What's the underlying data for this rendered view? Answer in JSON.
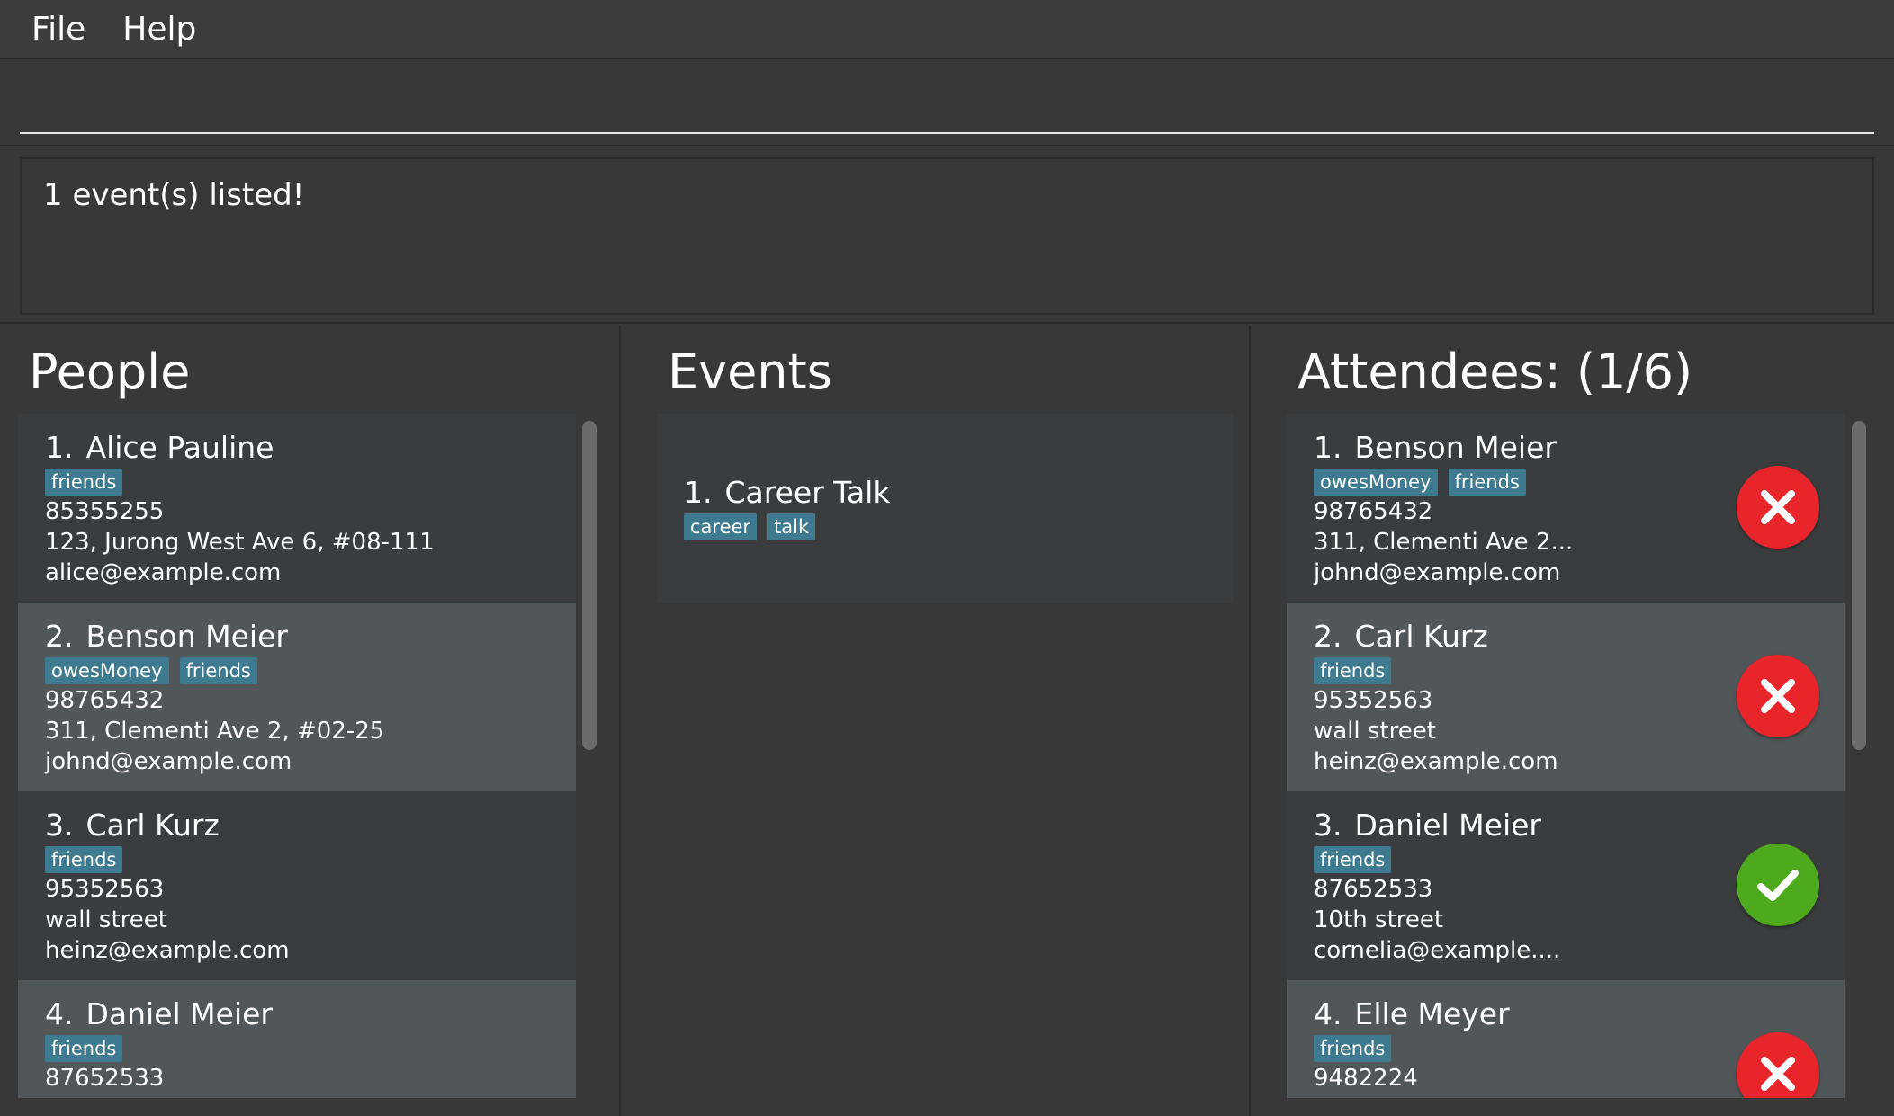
{
  "menu": {
    "items": [
      {
        "label": "File"
      },
      {
        "label": "Help"
      }
    ]
  },
  "command": {
    "value": "",
    "placeholder": ""
  },
  "result": {
    "text": "1 event(s) listed!"
  },
  "people": {
    "title": "People",
    "items": [
      {
        "index": "1.",
        "name": "Alice Pauline",
        "tags": [
          "friends"
        ],
        "phone": "85355255",
        "address": "123, Jurong West Ave 6, #08-111",
        "email": "alice@example.com"
      },
      {
        "index": "2.",
        "name": "Benson Meier",
        "tags": [
          "owesMoney",
          "friends"
        ],
        "phone": "98765432",
        "address": "311, Clementi Ave 2, #02-25",
        "email": "johnd@example.com"
      },
      {
        "index": "3.",
        "name": "Carl Kurz",
        "tags": [
          "friends"
        ],
        "phone": "95352563",
        "address": "wall street",
        "email": "heinz@example.com"
      },
      {
        "index": "4.",
        "name": "Daniel Meier",
        "tags": [
          "friends"
        ],
        "phone": "87652533",
        "address": "",
        "email": ""
      }
    ]
  },
  "events": {
    "title": "Events",
    "items": [
      {
        "index": "1.",
        "name": "Career Talk",
        "tags": [
          "career",
          "talk"
        ]
      }
    ]
  },
  "attendees": {
    "title": "Attendees: (1/6)",
    "items": [
      {
        "index": "1.",
        "name": "Benson Meier",
        "tags": [
          "owesMoney",
          "friends"
        ],
        "phone": "98765432",
        "address": "311, Clementi Ave 2...",
        "email": "johnd@example.com",
        "present": false
      },
      {
        "index": "2.",
        "name": "Carl Kurz",
        "tags": [
          "friends"
        ],
        "phone": "95352563",
        "address": "wall street",
        "email": "heinz@example.com",
        "present": false
      },
      {
        "index": "3.",
        "name": "Daniel Meier",
        "tags": [
          "friends"
        ],
        "phone": "87652533",
        "address": "10th street",
        "email": "cornelia@example....",
        "present": true
      },
      {
        "index": "4.",
        "name": "Elle Meyer",
        "tags": [
          "friends"
        ],
        "phone": "9482224",
        "address": "",
        "email": "",
        "present": false
      }
    ]
  },
  "colors": {
    "background": "#383838",
    "tag": "#3e7b91",
    "card_odd": "#3a3c3e",
    "card_even": "#515658",
    "absent": "#e8252b",
    "present": "#4caa1c"
  },
  "icons": {
    "absent": "close-icon",
    "present": "check-icon"
  }
}
